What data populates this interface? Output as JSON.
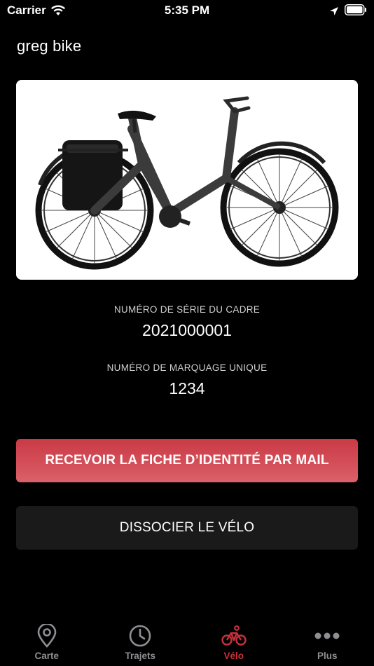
{
  "status_bar": {
    "carrier": "Carrier",
    "time": "5:35 PM"
  },
  "bike": {
    "name": "greg bike",
    "image_icon": "bike-photo"
  },
  "frame_serial": {
    "label": "NUMÉRO DE SÉRIE DU CADRE",
    "value": "2021000001"
  },
  "unique_marking": {
    "label": "NUMÉRO DE MARQUAGE UNIQUE",
    "value": "1234"
  },
  "actions": {
    "send_identity_label": "RECEVOIR LA FICHE D’IDENTITÉ PAR MAIL",
    "dissociate_label": "DISSOCIER LE VÉLO"
  },
  "tabs": [
    {
      "label": "Carte",
      "icon": "map-pin-icon",
      "active": false
    },
    {
      "label": "Trajets",
      "icon": "clock-icon",
      "active": false
    },
    {
      "label": "Vélo",
      "icon": "bike-icon",
      "active": true
    },
    {
      "label": "Plus",
      "icon": "more-icon",
      "active": false
    }
  ],
  "colors": {
    "accent": "#c8303b",
    "background": "#000000",
    "secondary_button": "#1a1a1a",
    "inactive_tab": "#8e8e93"
  }
}
